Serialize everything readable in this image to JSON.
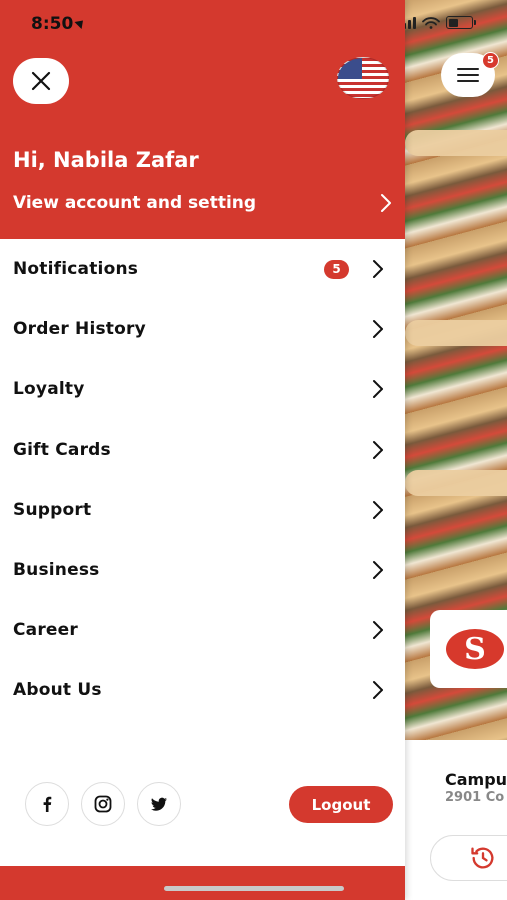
{
  "status_bar": {
    "time": "8:50",
    "battery_level": 0.45
  },
  "background": {
    "list_badge": "5",
    "store_name": "Campu",
    "store_address": "2901 Co"
  },
  "drawer": {
    "greeting": "Hi, Nabila Zafar",
    "account_link": "View account and setting",
    "menu": [
      {
        "label": "Notifications",
        "badge": "5"
      },
      {
        "label": "Order History"
      },
      {
        "label": "Loyalty"
      },
      {
        "label": "Gift Cards"
      },
      {
        "label": "Support"
      },
      {
        "label": "Business"
      },
      {
        "label": "Career"
      },
      {
        "label": "About Us"
      }
    ],
    "logout": "Logout",
    "social": [
      "facebook-icon",
      "instagram-icon",
      "twitter-icon"
    ]
  },
  "colors": {
    "brand_red": "#d4392e",
    "text": "#111111"
  }
}
